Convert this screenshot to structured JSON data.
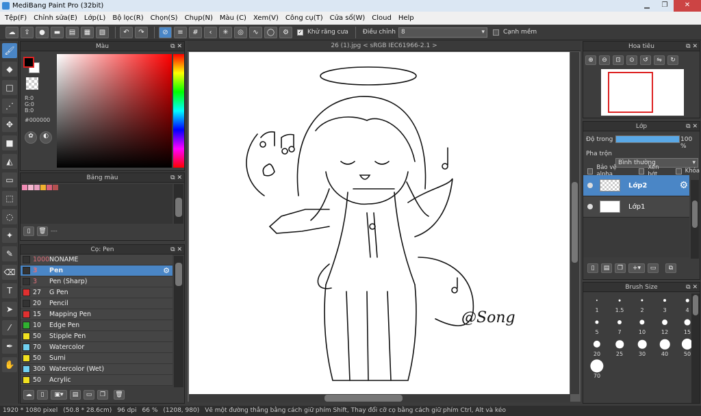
{
  "window": {
    "title": "MediBang Paint Pro (32bit)"
  },
  "menu": [
    "Tệp(F)",
    "Chỉnh sửa(E)",
    "Lớp(L)",
    "Bộ lọc(R)",
    "Chọn(S)",
    "Chụp(N)",
    "Màu (C)",
    "Xem(V)",
    "Công cụ(T)",
    "Cửa sổ(W)",
    "Cloud",
    "Help"
  ],
  "toolbar": {
    "antialias_label": "Khử răng cưa",
    "adjust_label": "Điều chỉnh",
    "adjust_value": "8",
    "soft_edge_label": "Cạnh mềm"
  },
  "color_panel": {
    "title": "Màu",
    "r": "R:0",
    "g": "G:0",
    "b": "B:0",
    "hex": "#000000",
    "fg": "#000000",
    "bg": "#ffffff"
  },
  "palette_panel": {
    "title": "Bảng màu",
    "swatches": [
      "#f08cb4",
      "#f4b8cf",
      "#e9a0c0",
      "#f0b030",
      "#d9607a",
      "#b45050"
    ],
    "footer": "---"
  },
  "brush_panel": {
    "title": "Cọ: Pen",
    "brushes": [
      {
        "size": "1000",
        "name": "NONAME",
        "color": "#333333",
        "red": true
      },
      {
        "size": "3",
        "name": "Pen",
        "color": "#333333",
        "red": true,
        "selected": true
      },
      {
        "size": "3",
        "name": "Pen (Sharp)",
        "color": "#333333",
        "red": true
      },
      {
        "size": "27",
        "name": "G Pen",
        "color": "#e03030"
      },
      {
        "size": "20",
        "name": "Pencil",
        "color": "#333333"
      },
      {
        "size": "15",
        "name": "Mapping Pen",
        "color": "#e03030"
      },
      {
        "size": "10",
        "name": "Edge Pen",
        "color": "#30b030"
      },
      {
        "size": "50",
        "name": "Stipple Pen",
        "color": "#f0e020"
      },
      {
        "size": "70",
        "name": "Watercolor",
        "color": "#70d0f0"
      },
      {
        "size": "50",
        "name": "Sumi",
        "color": "#f0e020"
      },
      {
        "size": "300",
        "name": "Watercolor (Wet)",
        "color": "#70d0f0"
      },
      {
        "size": "50",
        "name": "Acrylic",
        "color": "#f0e020"
      }
    ]
  },
  "canvas": {
    "tab_title": "26 (1).jpg < sRGB IEC61966-2.1 >",
    "signature": "@Song"
  },
  "navigator": {
    "title": "Hoa tiêu"
  },
  "layer_panel": {
    "title": "Lớp",
    "opacity_label": "Độ trong",
    "opacity_value": "100 %",
    "opacity_fraction": 1.0,
    "blend_label": "Pha trộn",
    "blend_value": "Bình thường",
    "protect_alpha": "Bảo vệ alpha",
    "clipping": "Xén bớt",
    "lock": "Khóa",
    "layers": [
      {
        "name": "Lớp2",
        "selected": true
      },
      {
        "name": "Lớp1",
        "selected": false
      }
    ]
  },
  "brush_size_panel": {
    "title": "Brush Size",
    "sizes": [
      "1",
      "1.5",
      "2",
      "3",
      "4",
      "5",
      "7",
      "10",
      "12",
      "15",
      "20",
      "25",
      "30",
      "40",
      "50",
      "70"
    ]
  },
  "status": {
    "dimensions": "1920 * 1080 pixel",
    "physical": "(50.8 * 28.6cm)",
    "dpi": "96 dpi",
    "zoom": "66 %",
    "coords": "(1208, 980)",
    "hint": "Vẽ một đường thẳng bằng cách giữ phím Shift, Thay đổi cỡ cọ bằng cách giữ phím Ctrl, Alt và kéo"
  }
}
